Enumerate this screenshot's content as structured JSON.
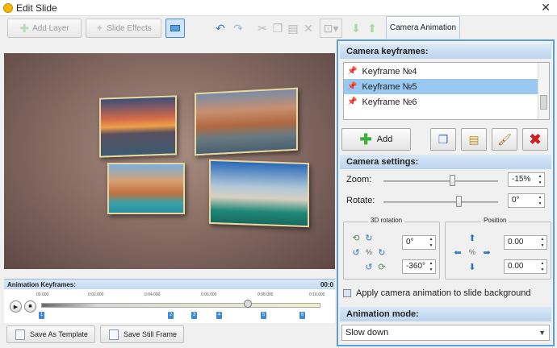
{
  "window": {
    "title": "Edit Slide",
    "close": "✕"
  },
  "toolbar": {
    "add_layer": "Add Layer",
    "slide_effects": "Slide Effects",
    "tab_camera": "Camera Animation"
  },
  "timeline": {
    "header": "Animation Keyframes:",
    "time_right": "00:0",
    "ticks": [
      "00.000",
      "0:02.000",
      "0:04.000",
      "0:06.000",
      "0:08.000",
      "0:10.000"
    ],
    "markers": [
      "1",
      "2",
      "3",
      "4",
      "5",
      "6"
    ],
    "position_fraction": 0.74
  },
  "bottom": {
    "save_template": "Save As Template",
    "save_frame": "Save Still Frame"
  },
  "panel": {
    "keyframes_title": "Camera keyframes:",
    "keyframes": [
      {
        "label": "Keyframe №4",
        "selected": false
      },
      {
        "label": "Keyframe №5",
        "selected": true
      },
      {
        "label": "Keyframe №6",
        "selected": false
      }
    ],
    "add_label": "Add",
    "settings_title": "Camera settings:",
    "zoom_label": "Zoom:",
    "zoom_value": "-15%",
    "rotate_label": "Rotate:",
    "rotate_value": "0°",
    "rotation_group": "3D rotation",
    "rot_x": "0°",
    "rot_y": "-360°",
    "position_group": "Position",
    "pos_x": "0.00",
    "pos_y": "0.00",
    "bg_checkbox": "Apply camera animation to slide background",
    "mode_title": "Animation mode:",
    "mode_value": "Slow down"
  }
}
